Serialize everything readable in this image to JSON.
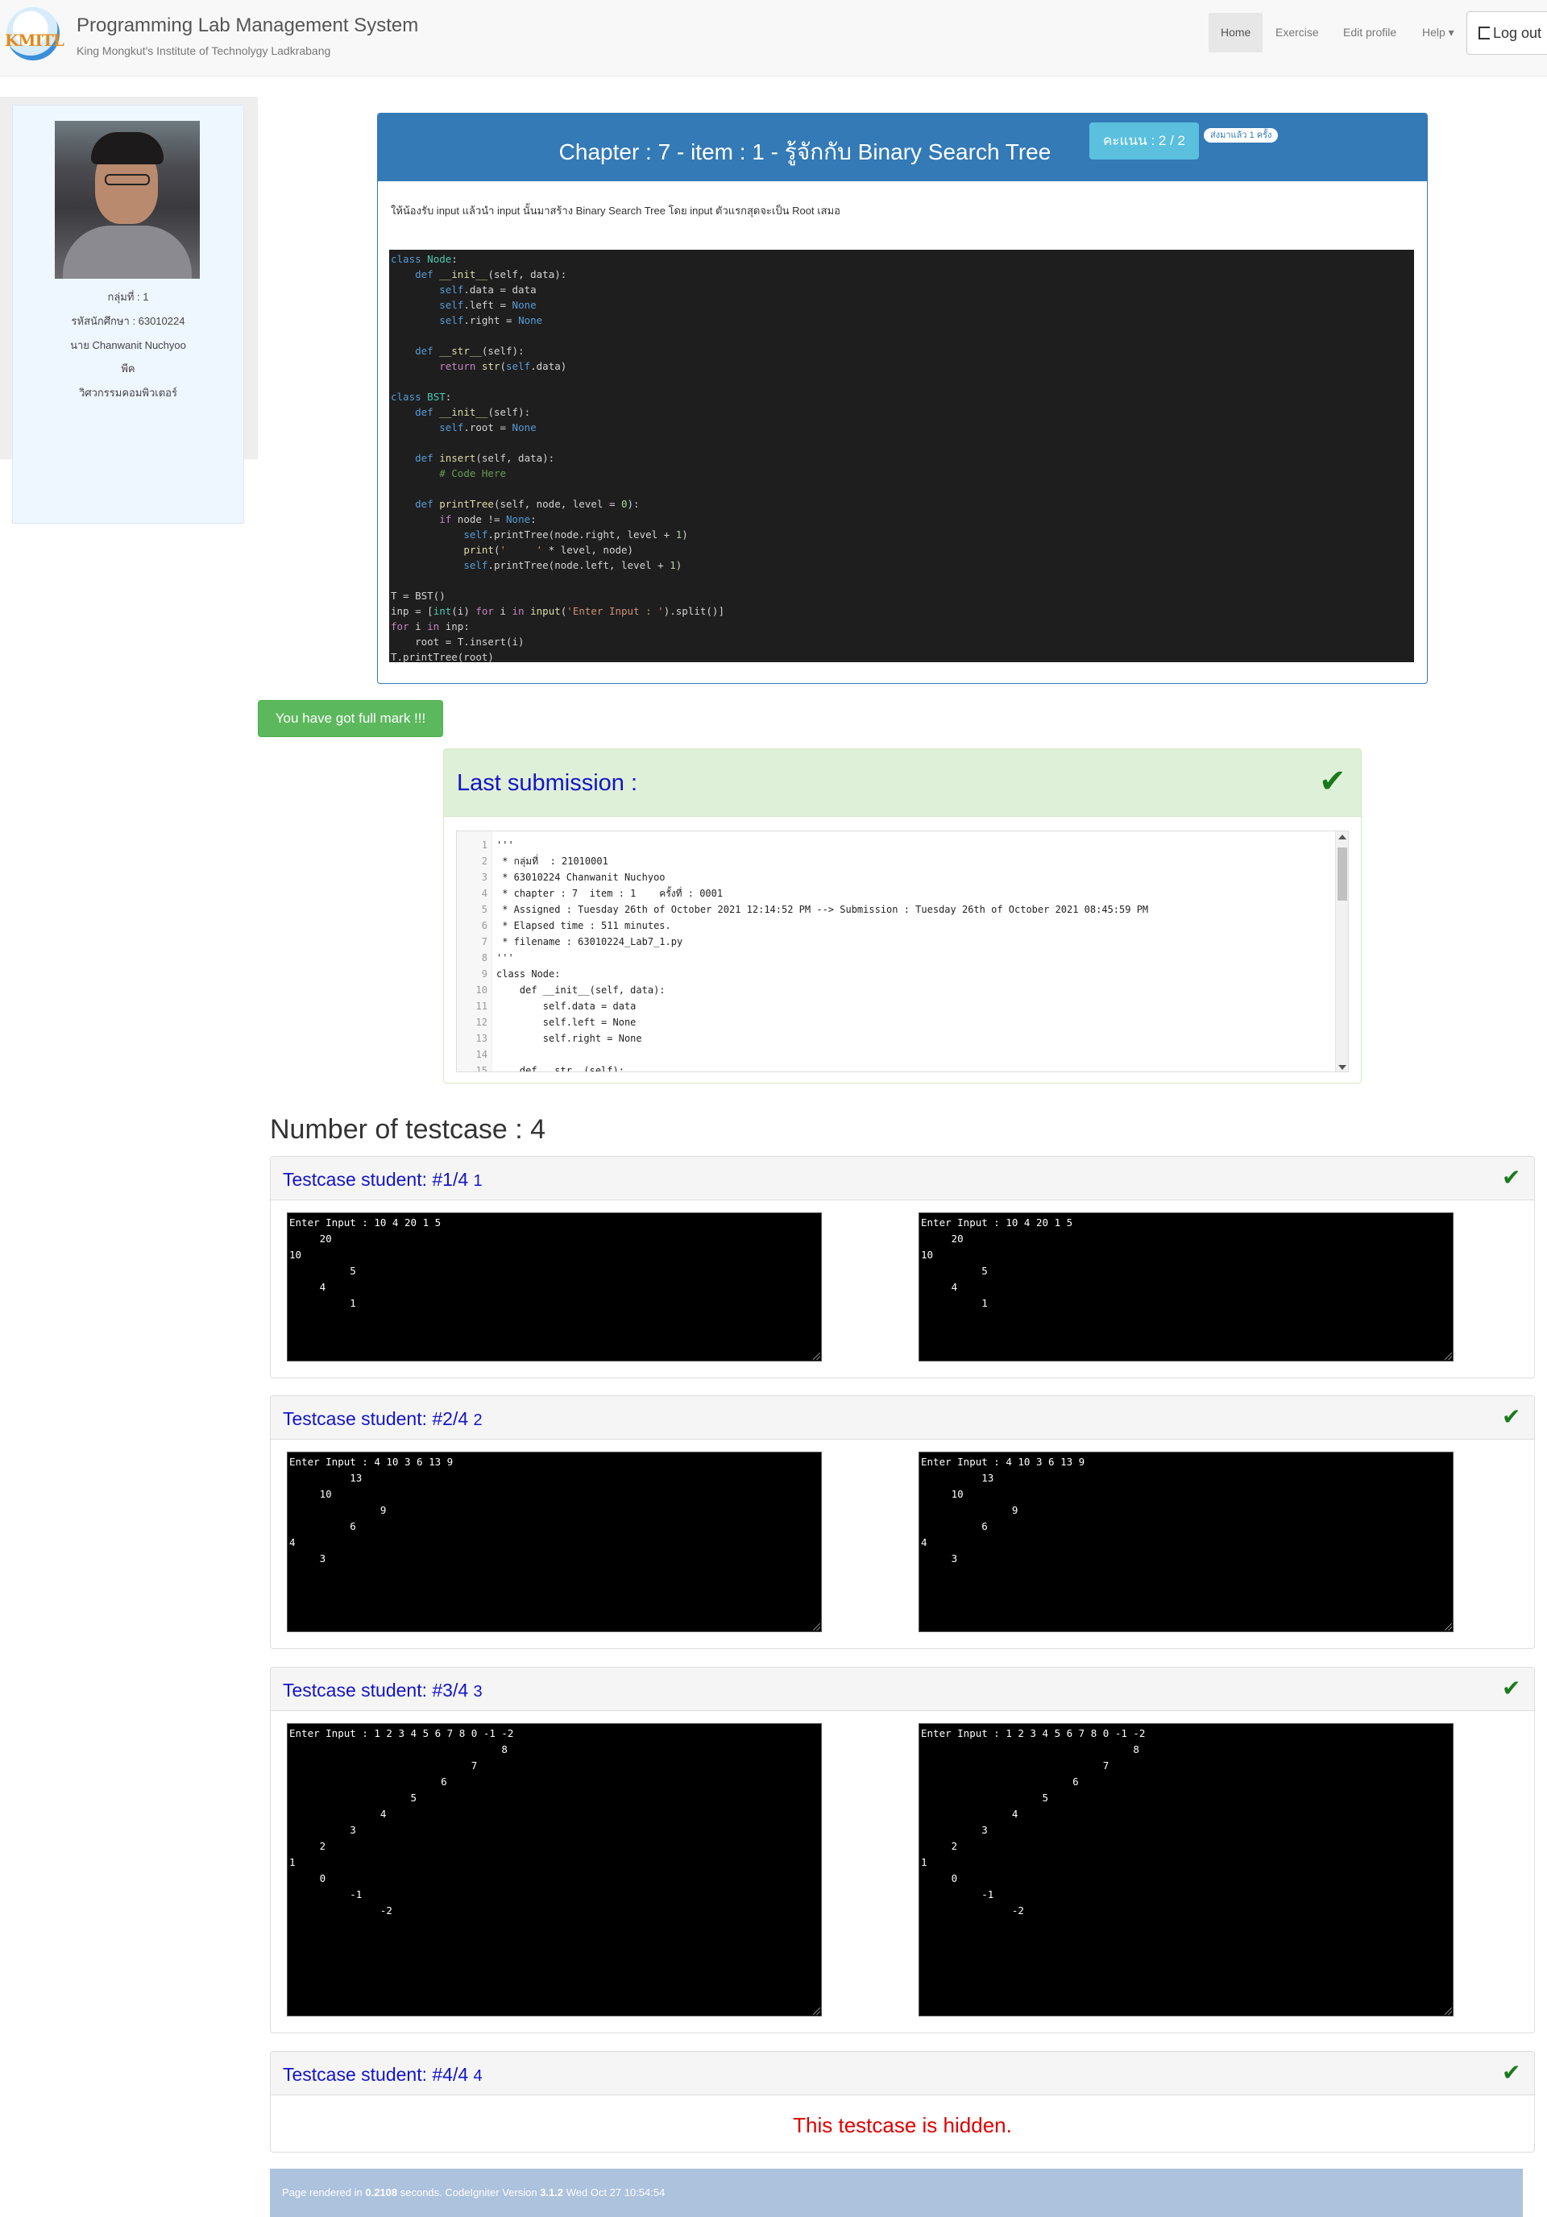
{
  "navbar": {
    "logo_text": "KMITL",
    "title": "Programming Lab Management System",
    "subtitle": "King Mongkut's Institute of Technolygy Ladkrabang",
    "home": "Home",
    "exercise": "Exercise",
    "edit_profile": "Edit profile",
    "help": "Help ▾",
    "logout": "Log out"
  },
  "profile": {
    "group": "กลุ่มที่ : 1",
    "student_id": "รหัสนักศึกษา : 63010224",
    "name": "นาย Chanwanit Nuchyoo",
    "nickname": "พีค",
    "department": "วิศวกรรมคอมพิวเตอร์"
  },
  "exercise": {
    "title": "Chapter : 7 - item : 1 - รู้จักกับ Binary Search Tree",
    "score": "คะแนน : 2 / 2",
    "sent": "ส่งมาแล้ว 1 ครั้ง",
    "description": "ให้น้องรับ input แล้วนำ input นั้นมาสร้าง Binary Search Tree โดย input ตัวแรกสุดจะเป็น Root เสมอ"
  },
  "full_mark": "You have got full mark !!!",
  "submission": {
    "title": "Last submission :",
    "lines": [
      {
        "n": "1",
        "t": "'''"
      },
      {
        "n": "2",
        "t": " * กลุ่มที่  : 21010001"
      },
      {
        "n": "3",
        "t": " * 63010224 Chanwanit Nuchyoo"
      },
      {
        "n": "4",
        "t": " * chapter : 7  item : 1    ครั้งที่ : 0001"
      },
      {
        "n": "5",
        "t": " * Assigned : Tuesday 26th of October 2021 12:14:52 PM --> Submission : Tuesday 26th of October 2021 08:45:59 PM"
      },
      {
        "n": "6",
        "t": " * Elapsed time : 511 minutes."
      },
      {
        "n": "7",
        "t": " * filename : 63010224_Lab7_1.py"
      },
      {
        "n": "8",
        "t": "'''"
      },
      {
        "n": "9",
        "t": "class Node:"
      },
      {
        "n": "10",
        "t": "    def __init__(self, data):"
      },
      {
        "n": "11",
        "t": "        self.data = data"
      },
      {
        "n": "12",
        "t": "        self.left = None"
      },
      {
        "n": "13",
        "t": "        self.right = None"
      },
      {
        "n": "14",
        "t": ""
      },
      {
        "n": "15",
        "t": "    def __str__(self):"
      }
    ]
  },
  "testcases": {
    "count_label": "Number of testcase : 4",
    "items": [
      {
        "title": "Testcase student: #1/4",
        "num": "1",
        "output": "Enter Input : 10 4 20 1 5\n     20\n10\n          5\n     4\n          1",
        "expected": "Enter Input : 10 4 20 1 5\n     20\n10\n          5\n     4\n          1"
      },
      {
        "title": "Testcase student: #2/4",
        "num": "2",
        "output": "Enter Input : 4 10 3 6 13 9\n          13\n     10\n               9\n          6\n4\n     3",
        "expected": "Enter Input : 4 10 3 6 13 9\n          13\n     10\n               9\n          6\n4\n     3"
      },
      {
        "title": "Testcase student: #3/4",
        "num": "3",
        "output": "Enter Input : 1 2 3 4 5 6 7 8 0 -1 -2\n                                   8\n                              7\n                         6\n                    5\n               4\n          3\n     2\n1\n     0\n          -1\n               -2",
        "expected": "Enter Input : 1 2 3 4 5 6 7 8 0 -1 -2\n                                   8\n                              7\n                         6\n                    5\n               4\n          3\n     2\n1\n     0\n          -1\n               -2"
      },
      {
        "title": "Testcase student: #4/4",
        "num": "4",
        "hidden_message": "This testcase is hidden."
      }
    ]
  },
  "footer": {
    "prefix": "Page rendered in ",
    "seconds": "0.2108",
    "middle": " seconds. CodeIgniter Version ",
    "version": "3.1.2",
    "suffix": " Wed Oct 27 10:54:54"
  }
}
